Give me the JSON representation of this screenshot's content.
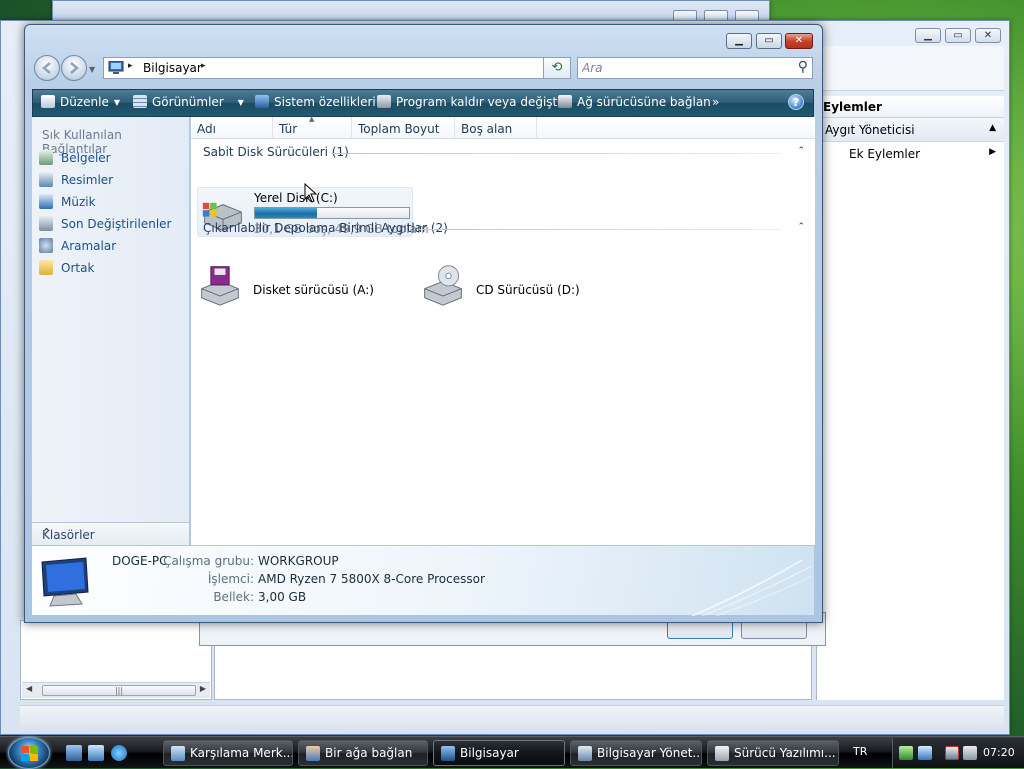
{
  "background_windows": {
    "management_window": {
      "actions_header": "Eylemler",
      "actions": [
        {
          "label": "Aygıt Yöneticisi",
          "icon": "collapse-up-icon"
        },
        {
          "label": "Ek Eylemler",
          "icon": "expand-right-icon"
        }
      ],
      "scrollbar_grip": "|||"
    },
    "dialog_buttons": [
      " ",
      " "
    ]
  },
  "explorer": {
    "address": {
      "location": "Bilgisayar",
      "separator": "▸"
    },
    "search": {
      "placeholder": "Ara"
    },
    "command_bar": [
      {
        "label": "Düzenle",
        "icon": "organize-icon",
        "dropdown": true
      },
      {
        "label": "Görünümler",
        "icon": "views-icon",
        "dropdown": true
      },
      {
        "label": "Sistem özellikleri",
        "icon": "system-properties-icon",
        "dropdown": false
      },
      {
        "label": "Program kaldır veya değiştir",
        "icon": "uninstall-program-icon",
        "dropdown": false
      },
      {
        "label": "Ağ sürücüsüne bağlan",
        "icon": "map-network-drive-icon",
        "dropdown": false
      }
    ],
    "more_commands": "»",
    "help": "?",
    "nav_pane": {
      "header": "Sık Kullanılan Bağlantılar",
      "favorites": [
        {
          "label": "Belgeler",
          "icon": "documents-icon"
        },
        {
          "label": "Resimler",
          "icon": "pictures-icon"
        },
        {
          "label": "Müzik",
          "icon": "music-icon"
        },
        {
          "label": "Son Değiştirilenler",
          "icon": "recent-icon"
        },
        {
          "label": "Aramalar",
          "icon": "searches-icon"
        },
        {
          "label": "Ortak",
          "icon": "public-folder-icon"
        }
      ],
      "folders_label": "Klasörler"
    },
    "columns": [
      "Adı",
      "Tür",
      "Toplam Boyut",
      "Boş alan"
    ],
    "groups": {
      "hard_disks": {
        "header": "Sabit Disk Sürücüleri (1)",
        "drives": [
          {
            "name": "Yerel Disk (C:)",
            "space": "30,1 GB boş, 49,9 GB toplam",
            "used_fraction": 0.4
          }
        ]
      },
      "removable": {
        "header": "Çıkarılabilir Depolama Birimli Aygıtlar (2)",
        "drives": [
          {
            "name": "Disket sürücüsü (A:)",
            "icon": "floppy-drive-icon"
          },
          {
            "name": "CD Sürücüsü (D:)",
            "icon": "cd-drive-icon"
          }
        ]
      }
    },
    "details": {
      "computer_name": "DOGE-PC",
      "workgroup_label": "Çalışma grubu:",
      "workgroup": "WORKGROUP",
      "processor_label": "İşlemci:",
      "processor": "AMD Ryzen 7 5800X 8-Core Processor",
      "memory_label": "Bellek:",
      "memory": "3,00 GB"
    }
  },
  "taskbar": {
    "tasks": [
      {
        "label": "Karşılama Merk...",
        "active": false
      },
      {
        "label": "Bir ağa bağlan",
        "active": false
      },
      {
        "label": "Bilgisayar",
        "active": true
      },
      {
        "label": "Bilgisayar Yönet...",
        "active": false
      },
      {
        "label": "Sürücü Yazılımı...",
        "active": false
      }
    ],
    "language": "TR",
    "clock": "07:20"
  },
  "colors": {
    "accent": "#2e5d78",
    "progress_fill": "#1b6fa8",
    "link_text": "#1e4f8c"
  }
}
